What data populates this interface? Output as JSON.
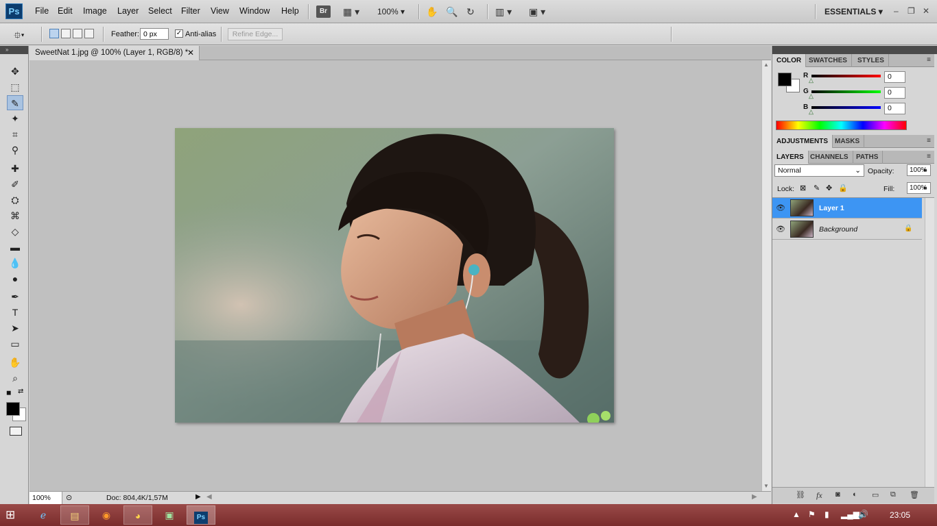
{
  "app": {
    "logo": "Ps",
    "menu": [
      "File",
      "Edit",
      "Image",
      "Layer",
      "Select",
      "Filter",
      "View",
      "Window",
      "Help"
    ],
    "bridge_label": "Br",
    "zoom_menu": "100%",
    "workspace": "ESSENTIALS"
  },
  "options": {
    "feather_label": "Feather:",
    "feather_value": "0 px",
    "antialias_label": "Anti-alias",
    "antialias_checked": "✓",
    "refine_edge": "Refine Edge..."
  },
  "toolbar_header": "»",
  "document": {
    "tab_title": "SweetNat 1.jpg @ 100% (Layer 1, RGB/8) *",
    "zoom": "100%",
    "doc_info": "Doc: 804,4K/1,57M"
  },
  "color_panel": {
    "tabs": [
      "COLOR",
      "SWATCHES",
      "STYLES"
    ],
    "channels": [
      {
        "label": "R",
        "value": "0",
        "color": "#ff0000"
      },
      {
        "label": "G",
        "value": "0",
        "color": "#00ff00"
      },
      {
        "label": "B",
        "value": "0",
        "color": "#0000ff"
      }
    ]
  },
  "adjustments_panel": {
    "tabs": [
      "ADJUSTMENTS",
      "MASKS"
    ]
  },
  "layers_panel": {
    "tabs": [
      "LAYERS",
      "CHANNELS",
      "PATHS"
    ],
    "blend_mode": "Normal",
    "opacity_label": "Opacity:",
    "opacity_value": "100%",
    "lock_label": "Lock:",
    "fill_label": "Fill:",
    "fill_value": "100%",
    "layers": [
      {
        "name": "Layer 1",
        "selected": true
      },
      {
        "name": "Background",
        "selected": false
      }
    ],
    "bottom_fx": "fx"
  },
  "taskbar": {
    "clock": "23:05"
  },
  "colors": {
    "selection": "#3d95f3",
    "taskbar": "#8b3a3a",
    "canvas_bg": "#c0c0c0"
  }
}
